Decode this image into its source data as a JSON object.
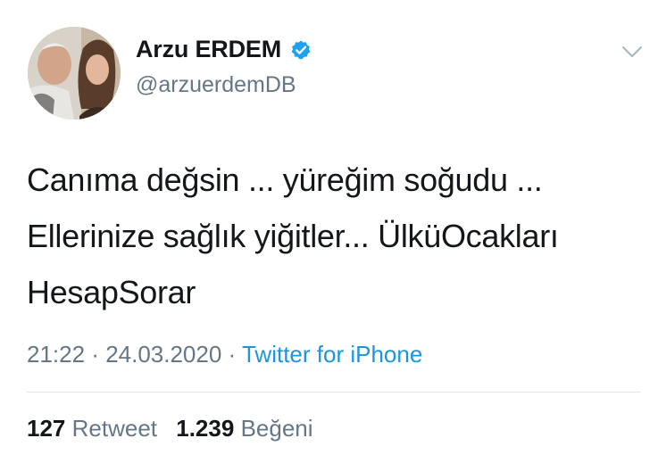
{
  "user": {
    "display_name": "Arzu ERDEM",
    "handle": "@arzuerdemDB",
    "verified": true,
    "verified_color": "#1da1f2"
  },
  "icons": {
    "menu": "chevron-down-icon",
    "verified": "verified-badge-icon"
  },
  "tweet": {
    "text": "Canıma değsin ... yüreğim soğudu ...\nEllerinize sağlık yiğitler... ÜlküOcakları\nHesapSorar"
  },
  "meta": {
    "time": "21:22",
    "separator": " · ",
    "date": "24.03.2020",
    "source": "Twitter for iPhone",
    "source_color": "#1b95e0"
  },
  "stats": {
    "retweets_count": "127",
    "retweets_label": "Retweet",
    "likes_count": "1.239",
    "likes_label": "Beğeni"
  }
}
